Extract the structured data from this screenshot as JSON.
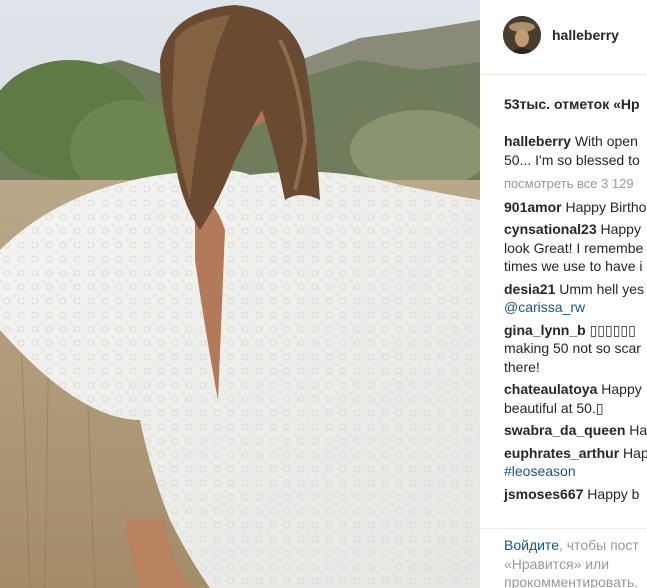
{
  "post": {
    "username": "halleberry",
    "likes": "53тыс. отметок «Нр",
    "more_comments": "посмотреть все 3 129"
  },
  "comments": [
    {
      "user": "halleberry",
      "lines": [
        "With open",
        "50... I'm so blessed to"
      ]
    },
    {
      "user": "901amor",
      "lines": [
        "Happy Birtho"
      ]
    },
    {
      "user": "cynsational23",
      "lines": [
        "Happy",
        "look Great! I remembe",
        "times we use to have i"
      ]
    },
    {
      "user": "desia21",
      "lines": [
        "Umm hell yes"
      ],
      "tag": "@carissa_rw"
    },
    {
      "user": "gina_lynn_b",
      "lines": [
        "▯▯▯▯▯▯",
        "making 50 not so scar",
        "there!"
      ]
    },
    {
      "user": "chateaulatoya",
      "lines": [
        "Happy",
        "beautiful at 50.▯"
      ]
    },
    {
      "user": "swabra_da_queen",
      "lines": [
        "Ha"
      ]
    },
    {
      "user": "euphrates_arthur",
      "lines": [
        "Hap"
      ],
      "tag": "#leoseason"
    },
    {
      "user": "jsmoses667",
      "lines": [
        "Happy b"
      ]
    }
  ],
  "footer": {
    "login": "Войдите",
    "rest1": ", чтобы пост",
    "line2": "«Нравится» или",
    "line3": "прокомментировать."
  },
  "colors": {
    "link": "#125688",
    "muted": "#999999",
    "text": "#262626"
  }
}
